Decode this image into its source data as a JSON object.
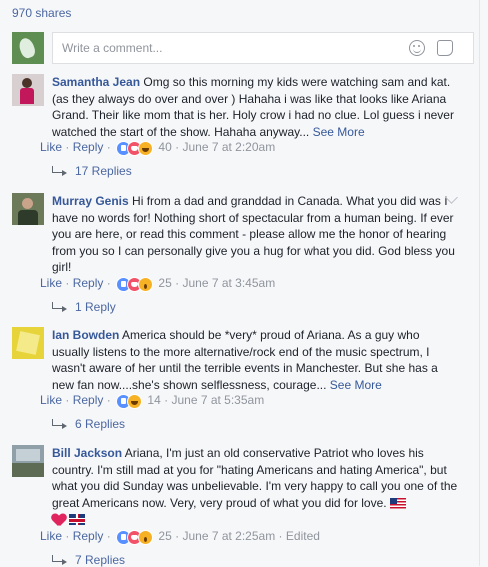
{
  "shares": "970 shares",
  "composer": {
    "placeholder": "Write a comment...",
    "icons": [
      "emoji-icon",
      "sticker-icon"
    ]
  },
  "actions": {
    "like": "Like",
    "reply": "Reply",
    "dot": "·"
  },
  "comments": [
    {
      "author": "Samantha Jean",
      "text": "Omg so this morning my kids were watching sam and kat.(as they always do over and over ) Hahaha i was like that looks like Ariana Grand. Their like mom that is her. Holy crow i had no clue. Lol guess i never watched the start of the show. Hahaha anyway...",
      "see_more": "See More",
      "reactions": [
        "like",
        "love",
        "haha"
      ],
      "count": "40",
      "time": "June 7 at 2:20am",
      "replies": "17 Replies",
      "avatar_color": "#b9a6a8"
    },
    {
      "author": "Murray Genis",
      "text": "Hi from a dad and granddad in Canada. What you did was I have no words for! Nothing short of spectacular from a human being. If ever you are here, or read this comment - please allow me the honor of hearing from you so I can personally give you a hug for what you did. God bless you girl!",
      "reactions": [
        "like",
        "love",
        "wow"
      ],
      "count": "25",
      "time": "June 7 at 3:45am",
      "replies": "1 Reply",
      "avatar_color": "#6d7a5a"
    },
    {
      "author": "Ian Bowden",
      "text": "America should be *very* proud of Ariana. As a guy who usually listens to the more alternative/rock end of the music spectrum, I wasn't aware of her until the terrible events in Manchester. But she has a new fan now....she's shown selflessness, courage...",
      "see_more": "See More",
      "reactions": [
        "like",
        "haha"
      ],
      "count": "14",
      "time": "June 7 at 5:35am",
      "replies": "6 Replies",
      "avatar_color": "#e7d43a"
    },
    {
      "author": "Bill Jackson",
      "text": "Ariana, I'm just an old conservative Patriot who loves his country. I'm still mad at you for \"hating Americans and hating America\", but what you did Sunday was unbelievable. I'm very happy to call you one of the great Americans now. Very, very proud of what you did for love.",
      "emojis": [
        "us-flag",
        "heart",
        "uk-flag"
      ],
      "reactions": [
        "like",
        "love",
        "wow"
      ],
      "count": "25",
      "time": "June 7 at 2:25am",
      "edited": "Edited",
      "replies": "7 Replies",
      "avatar_color": "#7f8a8f"
    }
  ]
}
